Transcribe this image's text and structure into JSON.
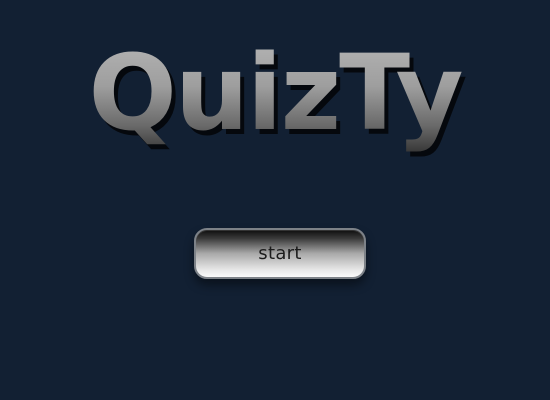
{
  "app": {
    "title": "QuizTy"
  },
  "start_screen": {
    "start_label": "start"
  },
  "colors": {
    "background": "#122033",
    "title_gradient_top": "#b9b9b9",
    "title_gradient_bottom": "#2c2c2c",
    "button_border": "#7d8288"
  }
}
